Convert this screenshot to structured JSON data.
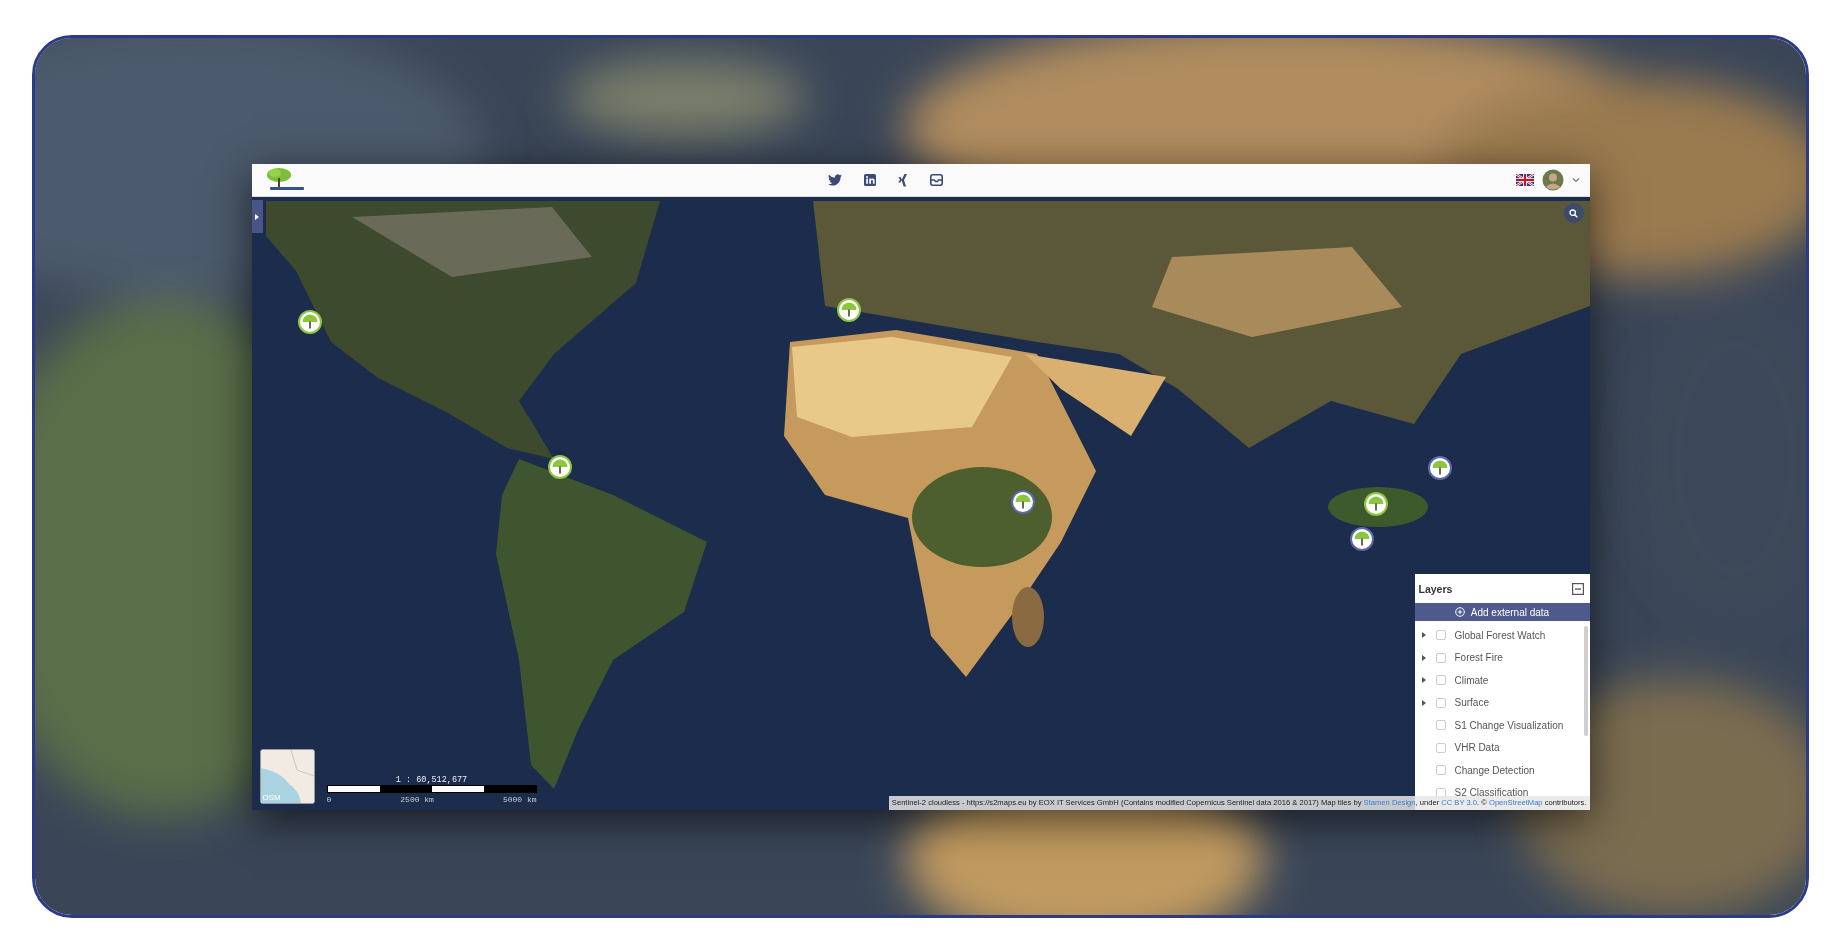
{
  "layers_panel": {
    "title": "Layers",
    "add_button": "Add external data",
    "items": [
      {
        "label": "Global Forest Watch",
        "kind": "group",
        "checked": false
      },
      {
        "label": "Forest Fire",
        "kind": "group",
        "checked": false
      },
      {
        "label": "Climate",
        "kind": "group",
        "checked": false
      },
      {
        "label": "Surface",
        "kind": "group",
        "checked": false
      },
      {
        "label": "S1 Change Visualization",
        "kind": "layer",
        "checked": false
      },
      {
        "label": "VHR Data",
        "kind": "layer",
        "checked": false
      },
      {
        "label": "Change Detection",
        "kind": "layer",
        "checked": false
      },
      {
        "label": "S2 Classification",
        "kind": "layer",
        "checked": false
      }
    ]
  },
  "minimap": {
    "label": "OSM"
  },
  "scale": {
    "ratio": "1 : 60,512,677",
    "ticks": [
      "0",
      "2500 km",
      "5000 km"
    ]
  },
  "attribution": {
    "parts": [
      {
        "kind": "text",
        "text": "Sentinel-2 cloudless - https://s2maps.eu by EOX IT Services GmbH (Contains modified Copernicus Sentinel data 2016 & 2017) Map tiles by "
      },
      {
        "kind": "link",
        "text": "Stamen Design"
      },
      {
        "kind": "text",
        "text": ", under "
      },
      {
        "kind": "link",
        "text": "CC BY 3.0"
      },
      {
        "kind": "text",
        "text": ". © "
      },
      {
        "kind": "link",
        "text": "OpenStreetMap"
      },
      {
        "kind": "text",
        "text": " contributors."
      }
    ]
  }
}
